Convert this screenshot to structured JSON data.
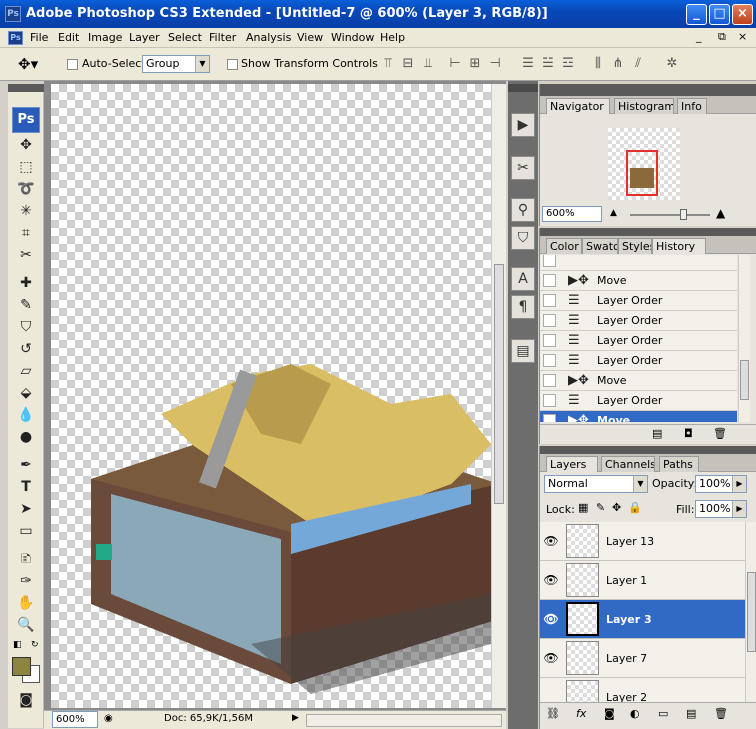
{
  "window": {
    "title": "Adobe Photoshop CS3 Extended - [Untitled-7 @ 600% (Layer 3, RGB/8)]",
    "app_badge": "Ps"
  },
  "menubar": {
    "items": [
      "File",
      "Edit",
      "Image",
      "Layer",
      "Select",
      "Filter",
      "Analysis",
      "View",
      "Window",
      "Help"
    ]
  },
  "options": {
    "auto_select_label": "Auto-Select:",
    "auto_select_value": "Group",
    "transform_label": "Show Transform Controls"
  },
  "toolbox": {
    "logo": "Ps"
  },
  "status": {
    "zoom": "600%",
    "doc": "Doc: 65,9K/1,56M"
  },
  "navigator": {
    "tabs": [
      "Navigator",
      "Histogram",
      "Info"
    ],
    "zoom": "600%"
  },
  "history": {
    "tabs": [
      "Color",
      "Swatches",
      "Styles",
      "History"
    ],
    "items": [
      {
        "label": "Move",
        "icon": "move-icon",
        "selected": false
      },
      {
        "label": "Layer Order",
        "icon": "layer-order-icon",
        "selected": false
      },
      {
        "label": "Layer Order",
        "icon": "layer-order-icon",
        "selected": false
      },
      {
        "label": "Layer Order",
        "icon": "layer-order-icon",
        "selected": false
      },
      {
        "label": "Layer Order",
        "icon": "layer-order-icon",
        "selected": false
      },
      {
        "label": "Move",
        "icon": "move-icon",
        "selected": false
      },
      {
        "label": "Layer Order",
        "icon": "layer-order-icon",
        "selected": false
      },
      {
        "label": "Move",
        "icon": "move-icon",
        "selected": true
      }
    ]
  },
  "layers": {
    "tabs": [
      "Layers",
      "Channels",
      "Paths"
    ],
    "blend_mode": "Normal",
    "opacity_label": "Opacity:",
    "opacity": "100%",
    "lock_label": "Lock:",
    "fill_label": "Fill:",
    "fill": "100%",
    "items": [
      {
        "name": "Layer 13",
        "visible": true,
        "selected": false
      },
      {
        "name": "Layer 1",
        "visible": true,
        "selected": false
      },
      {
        "name": "Layer 3",
        "visible": true,
        "selected": true
      },
      {
        "name": "Layer 7",
        "visible": true,
        "selected": false
      },
      {
        "name": "Layer 2",
        "visible": false,
        "selected": false
      }
    ]
  },
  "colors": {
    "title_bar": "#0a55d0",
    "selection": "#316ac5",
    "foreground_swatch": "#8c8440"
  }
}
